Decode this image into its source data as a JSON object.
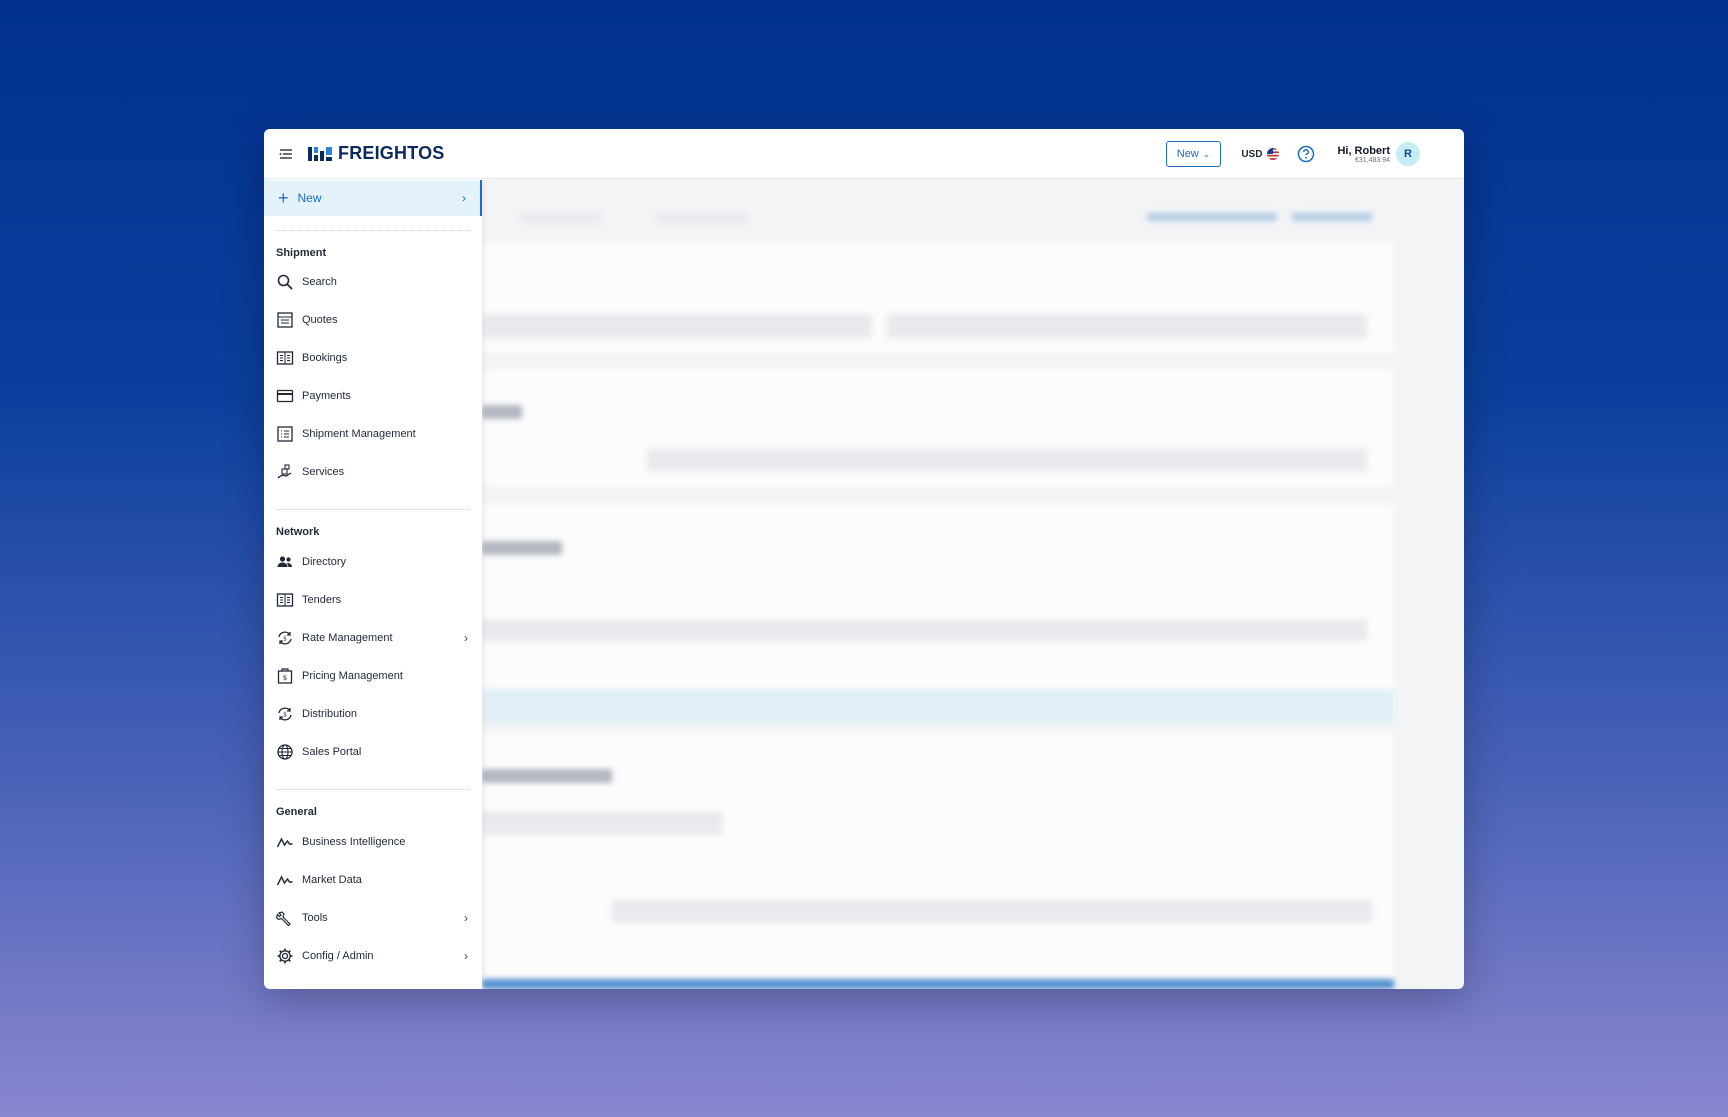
{
  "header": {
    "brand": "FREIGHTOS",
    "new_button": "New",
    "currency": "USD",
    "greeting": "Hi, Robert",
    "balance": "€31,483.94",
    "avatar_initial": "R"
  },
  "sidebar": {
    "new_label": "New",
    "sections": [
      {
        "title": "Shipment",
        "items": [
          {
            "label": "Search",
            "icon": "search-icon"
          },
          {
            "label": "Quotes",
            "icon": "quotes-icon"
          },
          {
            "label": "Bookings",
            "icon": "bookings-icon"
          },
          {
            "label": "Payments",
            "icon": "credit-card-icon"
          },
          {
            "label": "Shipment Management",
            "icon": "list-icon"
          },
          {
            "label": "Services",
            "icon": "services-icon"
          }
        ]
      },
      {
        "title": "Network",
        "items": [
          {
            "label": "Directory",
            "icon": "people-icon"
          },
          {
            "label": "Tenders",
            "icon": "tenders-icon"
          },
          {
            "label": "Rate Management",
            "icon": "rate-icon",
            "has_submenu": true
          },
          {
            "label": "Pricing Management",
            "icon": "pricing-icon"
          },
          {
            "label": "Distribution",
            "icon": "distribution-icon"
          },
          {
            "label": "Sales Portal",
            "icon": "globe-icon"
          }
        ]
      },
      {
        "title": "General",
        "items": [
          {
            "label": "Business Intelligence",
            "icon": "chart-line-icon"
          },
          {
            "label": "Market Data",
            "icon": "market-line-icon"
          },
          {
            "label": "Tools",
            "icon": "wrench-icon",
            "has_submenu": true
          },
          {
            "label": "Config / Admin",
            "icon": "gear-icon",
            "has_submenu": true
          }
        ]
      }
    ]
  },
  "colors": {
    "accent": "#1b6ec2",
    "brand_dark": "#0b2a5c",
    "active_bg": "#e4f2fb"
  }
}
